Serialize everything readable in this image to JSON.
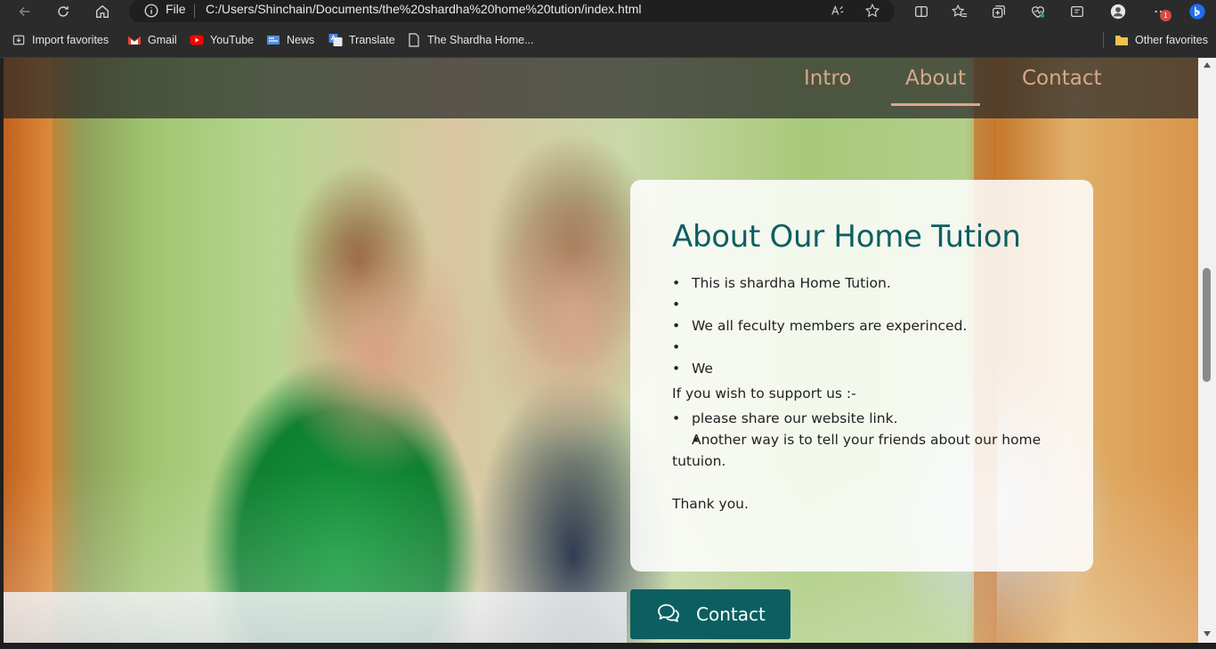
{
  "browser": {
    "address_scheme": "File",
    "url": "C:/Users/Shinchain/Documents/the%20shardha%20home%20tution/index.html",
    "notification_count": "1"
  },
  "bookmarks": [
    {
      "label": "Import favorites",
      "icon": "import-icon"
    },
    {
      "label": "Gmail",
      "icon": "gmail-icon"
    },
    {
      "label": "YouTube",
      "icon": "youtube-icon"
    },
    {
      "label": "News",
      "icon": "news-icon"
    },
    {
      "label": "Translate",
      "icon": "translate-icon"
    },
    {
      "label": "The Shardha Home...",
      "icon": "page-icon"
    }
  ],
  "other_favorites": "Other favorites",
  "nav": {
    "items": [
      "Intro",
      "About",
      "Contact"
    ],
    "active": "About",
    "color": "#d6a98a"
  },
  "about": {
    "title": "About Our Home Tution",
    "points": [
      "This is shardha Home Tution.",
      "We all feculty members are experinced.",
      "We"
    ],
    "support_intro": "If you wish to support us :-",
    "support_points": [
      "please share our website link.",
      "Another way is to tell your friends about our home tutuion."
    ],
    "closing": "Thank you.",
    "title_color": "#0e5f62"
  },
  "contact_button": {
    "label": "Contact",
    "icon": "chat-bubbles-icon",
    "color": "#0b5f61"
  }
}
